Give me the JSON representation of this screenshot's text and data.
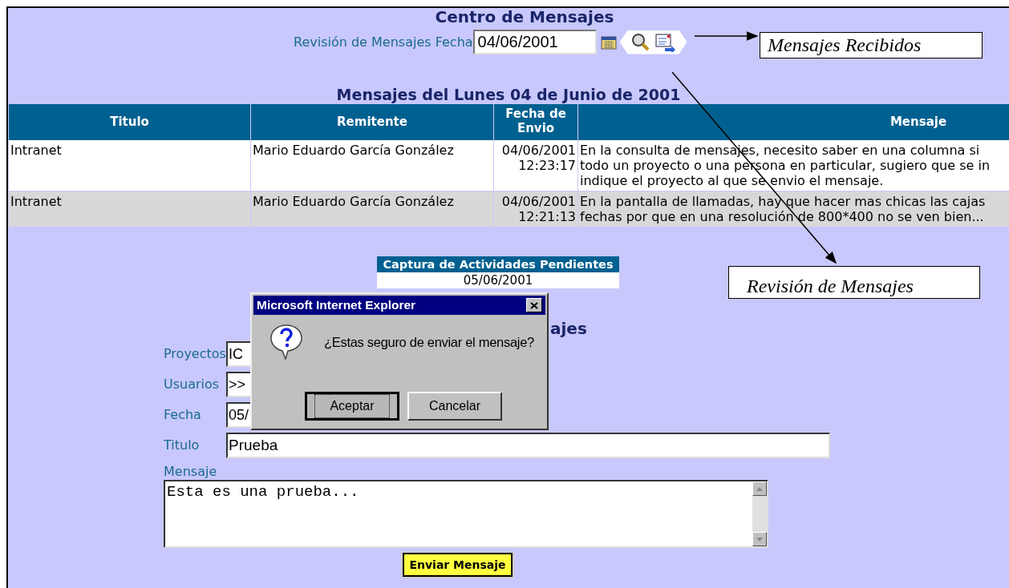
{
  "page": {
    "title": "Centro de Mensajes",
    "review_label": "Revisión de Mensajes Fecha",
    "review_date": "04/06/2001"
  },
  "messages": {
    "heading": "Mensajes del Lunes 04 de Junio de 2001",
    "columns": [
      "Titulo",
      "Remitente",
      "Fecha de Envio",
      "Mensaje"
    ],
    "rows": [
      {
        "titulo": "Intranet",
        "remitente": "Mario Eduardo García González",
        "fecha": "04/06/2001",
        "hora": "12:23:17",
        "mensaje": [
          "En la consulta de mensajes, necesito saber en una columna si",
          "todo un proyecto o una persona en particular, sugiero que se in",
          "indique el proyecto al que se envio el mensaje."
        ],
        "selected": false
      },
      {
        "titulo": "Intranet",
        "remitente": "Mario Eduardo García González",
        "fecha": "04/06/2001",
        "hora": "12:21:13",
        "mensaje": [
          "En la pantalla de llamadas, hay que hacer mas chicas las cajas",
          "fechas por que en una resolución de 800*400 no se ven bien..."
        ],
        "selected": true
      }
    ]
  },
  "pending": {
    "title": "Captura de Actividades Pendientes",
    "date": "05/06/2001"
  },
  "form": {
    "heading": "ajes",
    "fields": [
      {
        "label": "Proyectos",
        "value": "IC"
      },
      {
        "label": "Usuarios",
        "value": ">>"
      },
      {
        "label": "Fecha",
        "value": "05/"
      },
      {
        "label": "Titulo",
        "value": "Prueba"
      }
    ],
    "message_label": "Mensaje",
    "message_value": "Esta es una prueba...",
    "submit": "Enviar Mensaje"
  },
  "dialog": {
    "title": "Microsoft Internet Explorer",
    "text": "¿Estas seguro de enviar el mensaje?",
    "buttons": [
      {
        "label": "Aceptar",
        "focused": true
      },
      {
        "label": "Cancelar",
        "focused": false
      }
    ]
  },
  "callouts": [
    "Mensajes Recibidos",
    "Revisión de Mensajes"
  ]
}
